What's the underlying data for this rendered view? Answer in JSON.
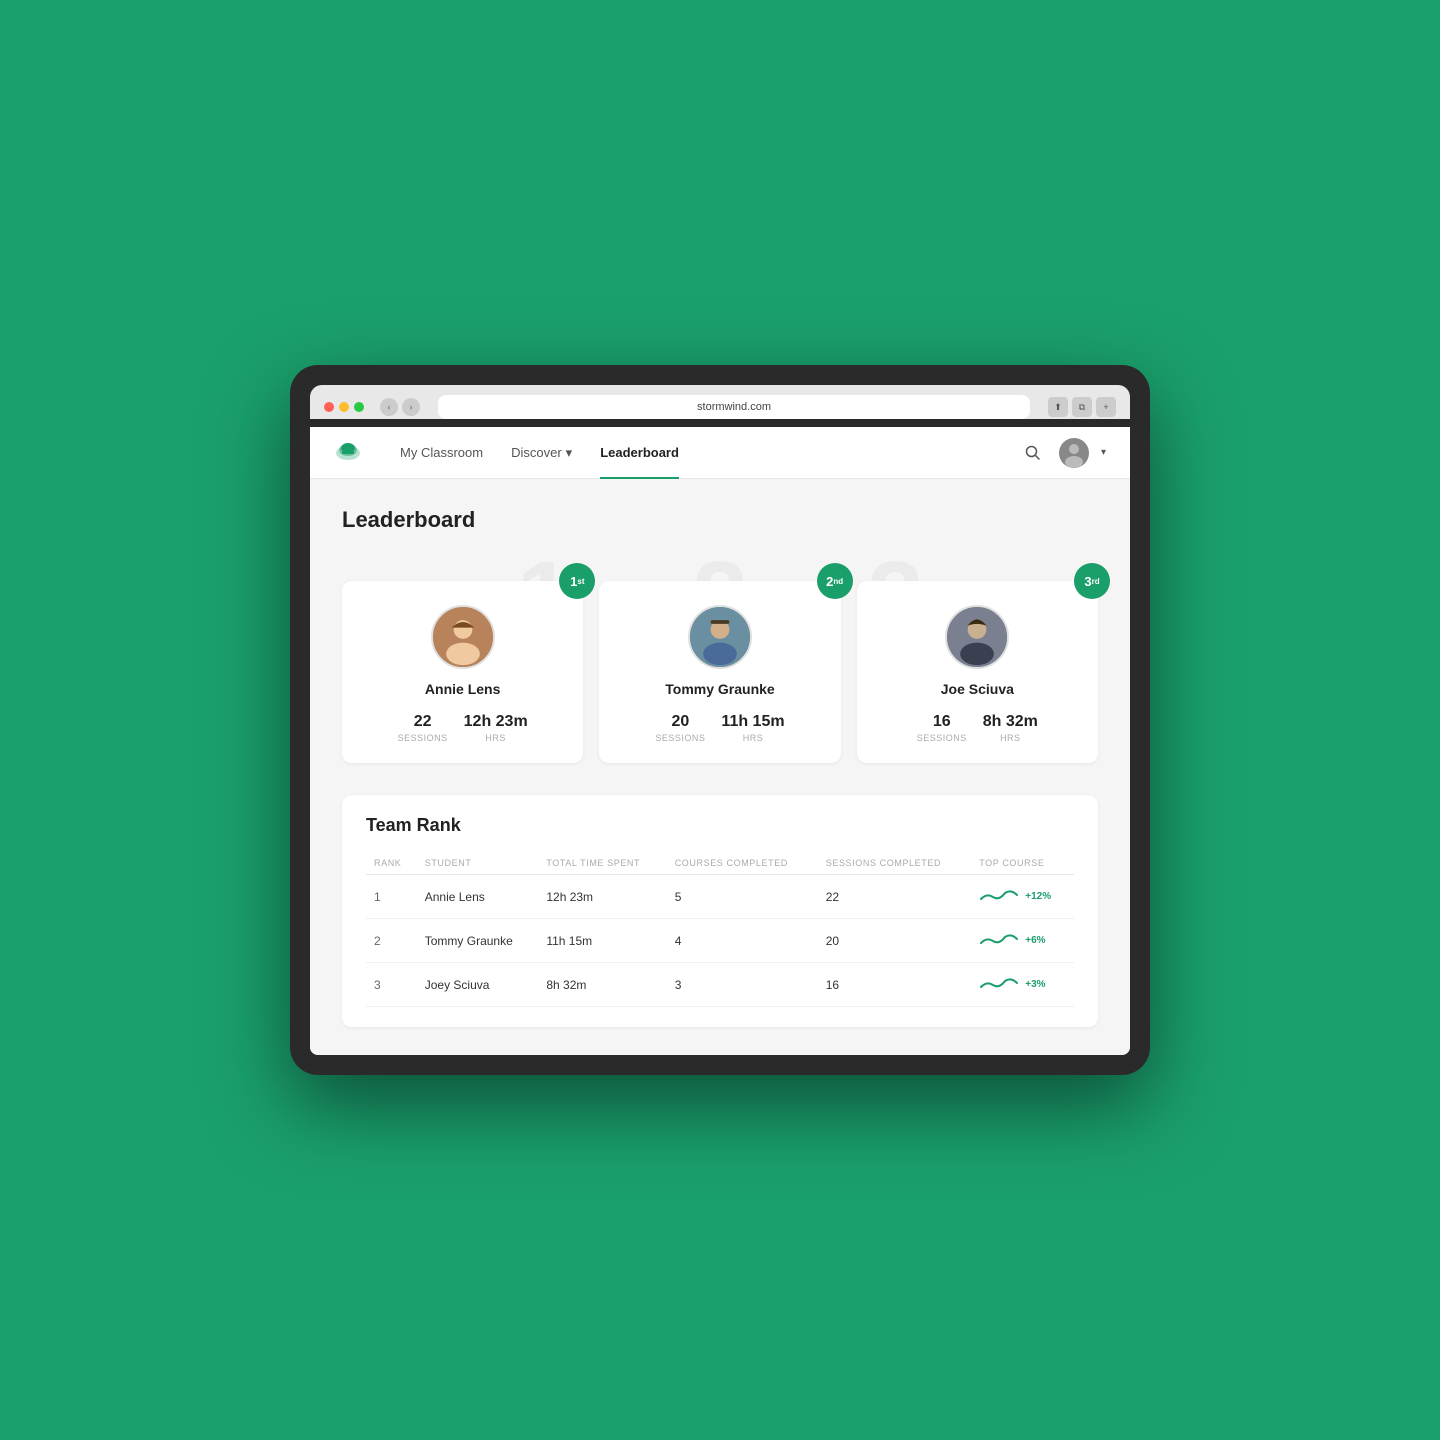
{
  "browser": {
    "url": "stormwind.com",
    "tab_new_label": "+"
  },
  "navbar": {
    "logo_alt": "StormWind Logo",
    "links": [
      {
        "label": "My Classroom",
        "active": false
      },
      {
        "label": "Discover",
        "dropdown": true,
        "active": false
      },
      {
        "label": "Leaderboard",
        "active": true
      }
    ],
    "search_title": "Search",
    "avatar_alt": "User Avatar"
  },
  "page": {
    "title": "Leaderboard",
    "team_rank_title": "Team Rank"
  },
  "leaderboard": {
    "cards": [
      {
        "rank": "1",
        "rank_suffix": "st",
        "name": "Annie Lens",
        "sessions": "22",
        "sessions_label": "SESSIONS",
        "hrs": "12h 23m",
        "hrs_label": "HRS"
      },
      {
        "rank": "2",
        "rank_suffix": "nd",
        "name": "Tommy Graunke",
        "sessions": "20",
        "sessions_label": "SESSIONS",
        "hrs": "11h 15m",
        "hrs_label": "HRS"
      },
      {
        "rank": "3",
        "rank_suffix": "rd",
        "name": "Joe Sciuva",
        "sessions": "16",
        "sessions_label": "SESSIONS",
        "hrs": "8h 32m",
        "hrs_label": "HRS"
      }
    ]
  },
  "team_rank": {
    "columns": [
      "RANK",
      "STUDENT",
      "TOTAL TIME SPENT",
      "COURSES COMPLETED",
      "SESSIONS COMPLETED",
      "TOP COURSE"
    ],
    "rows": [
      {
        "rank": "1",
        "student": "Annie Lens",
        "time": "12h 23m",
        "courses": "5",
        "sessions": "22",
        "trend": "+12%"
      },
      {
        "rank": "2",
        "student": "Tommy Graunke",
        "time": "11h 15m",
        "courses": "4",
        "sessions": "20",
        "trend": "+6%"
      },
      {
        "rank": "3",
        "student": "Joey Sciuva",
        "time": "8h 32m",
        "courses": "3",
        "sessions": "16",
        "trend": "+3%"
      }
    ]
  },
  "watermarks": [
    "1",
    "2",
    "3"
  ]
}
